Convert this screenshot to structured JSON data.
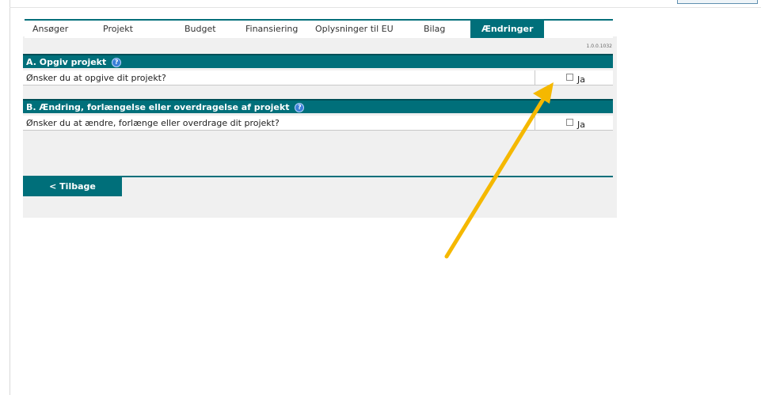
{
  "tabs": [
    {
      "label": "Ansøger"
    },
    {
      "label": "Projekt"
    },
    {
      "label": "Budget"
    },
    {
      "label": "Finansiering"
    },
    {
      "label": "Oplysninger til EU"
    },
    {
      "label": "Bilag"
    },
    {
      "label": "Ændringer",
      "active": true
    }
  ],
  "version": "1.0.0.1032",
  "sectionA": {
    "title": "A. Opgiv projekt",
    "question": "Ønsker du at opgive dit projekt?",
    "option_label": "Ja",
    "checked": false
  },
  "sectionB": {
    "title": "B. Ændring, forlængelse eller overdragelse af projekt",
    "question": "Ønsker du at ændre, forlænge eller overdrage dit projekt?",
    "option_label": "Ja",
    "checked": false
  },
  "back_button": "< Tilbage",
  "help_icon_glyph": "?",
  "colors": {
    "accent": "#006f7a",
    "annotation_arrow": "#f5b800"
  }
}
